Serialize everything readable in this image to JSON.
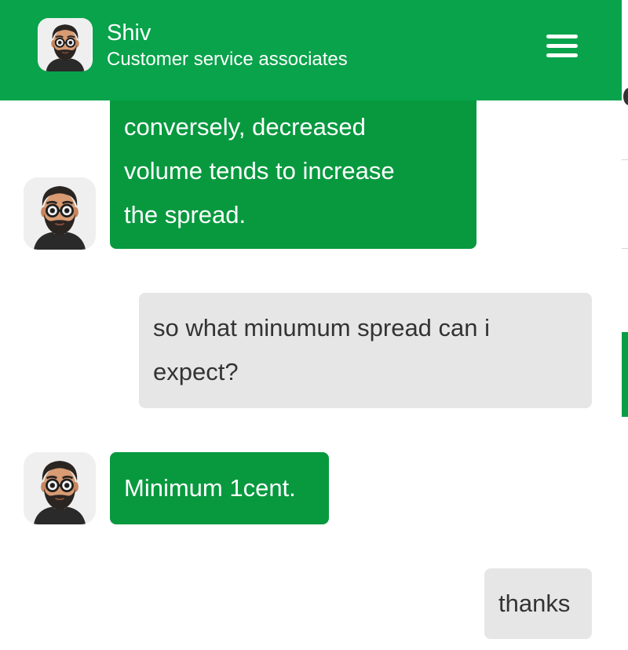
{
  "header": {
    "agent_name": "Shiv",
    "agent_role": "Customer service associates",
    "avatar_icon": "bearded-man-avatar-icon",
    "menu_icon": "hamburger-menu-icon"
  },
  "colors": {
    "header_bg": "#08a34b",
    "agent_bubble": "#08993f",
    "user_bubble": "#e6e6e6",
    "user_text": "#333333"
  },
  "messages": [
    {
      "sender": "agent",
      "lines": [
        "conversely, decreased",
        "volume tends to increase",
        "the spread."
      ]
    },
    {
      "sender": "user",
      "lines": [
        "so what minumum spread can i",
        "expect?"
      ]
    },
    {
      "sender": "agent",
      "lines": [
        "Minimum 1cent."
      ]
    },
    {
      "sender": "user",
      "lines": [
        "thanks"
      ]
    }
  ]
}
